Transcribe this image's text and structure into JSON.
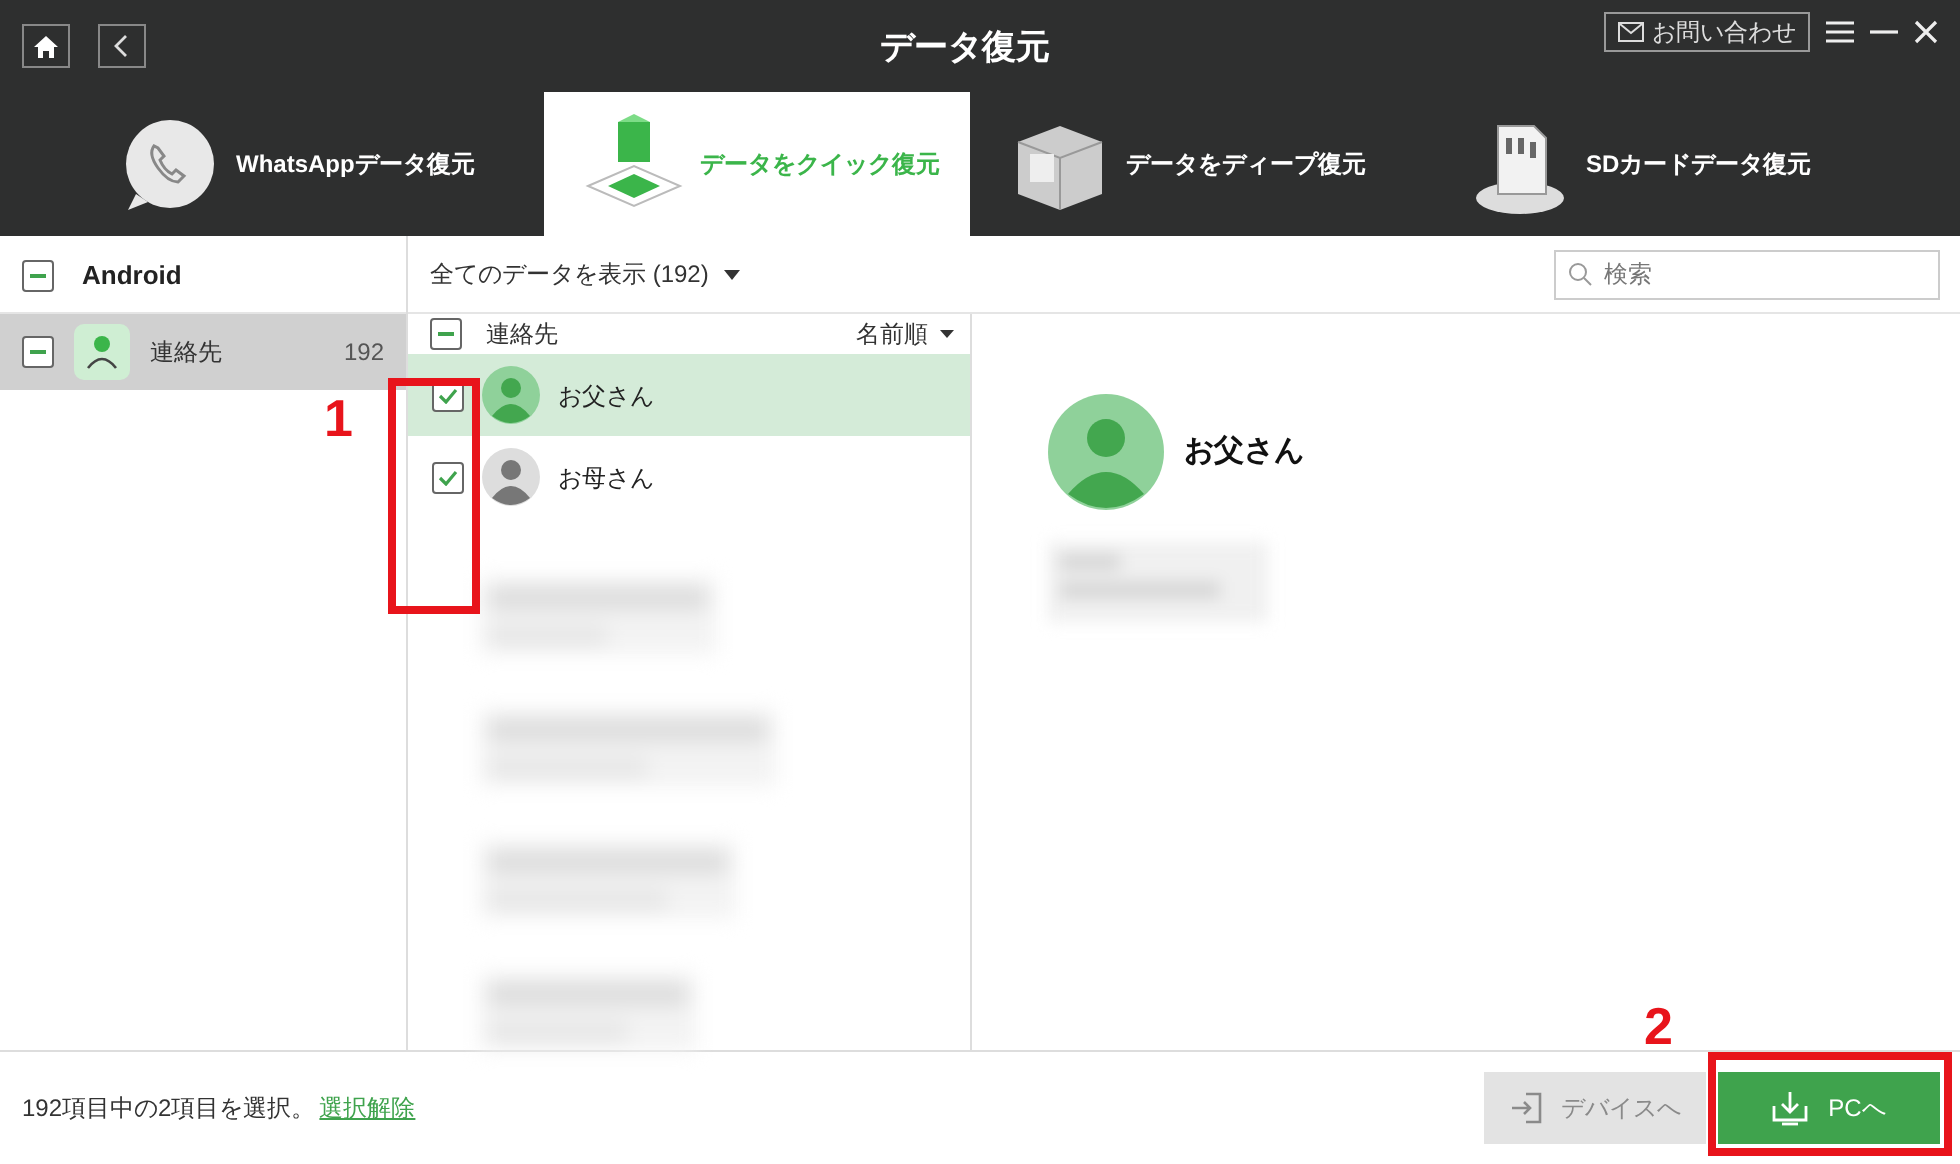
{
  "window": {
    "title": "データ復元",
    "contact_button": "お問い合わせ"
  },
  "tabs": [
    {
      "label": "WhatsAppデータ復元",
      "kind": "chat",
      "selected": false
    },
    {
      "label": "データをクイック復元",
      "kind": "cube",
      "selected": true
    },
    {
      "label": "データをディープ復元",
      "kind": "box",
      "selected": false
    },
    {
      "label": "SDカードデータ復元",
      "kind": "sd",
      "selected": false
    }
  ],
  "sidebar": {
    "device": "Android",
    "device_partial": true,
    "items": [
      {
        "label": "連絡先",
        "count": "192",
        "partial": true,
        "selected": true
      }
    ]
  },
  "toolbar": {
    "filter": "全てのデータを表示 (192)",
    "search": {
      "placeholder": "検索"
    }
  },
  "list": {
    "header": "連絡先",
    "header_partial": true,
    "sort": "名前順",
    "rows": [
      {
        "name": "お父さん",
        "checked": true,
        "selected": true
      },
      {
        "name": "お母さん",
        "checked": true,
        "selected": false
      }
    ]
  },
  "detail": {
    "name": "お父さん"
  },
  "status_bar": {
    "text": "192項目中の2項目を選択。",
    "link": "選択解除"
  },
  "buttons": [
    {
      "label": "デバイスへ",
      "kind": "device",
      "disabled": true
    },
    {
      "label": "PCへ",
      "kind": "pc",
      "disabled": false
    }
  ],
  "annotations": [
    {
      "label": "1"
    },
    {
      "label": "2"
    }
  ]
}
